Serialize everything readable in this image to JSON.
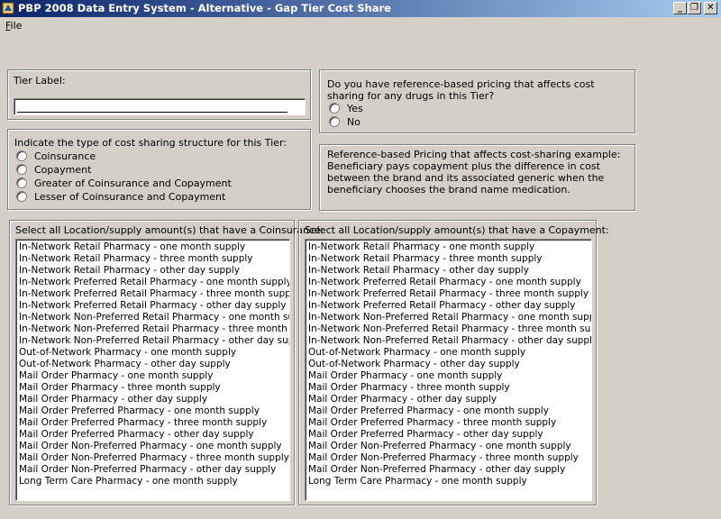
{
  "window": {
    "title": "PBP 2008 Data Entry System - Alternative - Gap Tier Cost Share",
    "minimize": "_",
    "restore": "❐",
    "close": "✕"
  },
  "menu": {
    "file_label_accel": "F",
    "file_label_rest": "ile"
  },
  "tier_label": {
    "caption": "Tier Label:",
    "value": ""
  },
  "reference_pricing": {
    "question": "Do you have reference-based pricing that affects cost sharing for any drugs in this Tier?",
    "options": [
      "Yes",
      "No"
    ]
  },
  "cost_sharing": {
    "caption": "Indicate the type of cost sharing structure for this Tier:",
    "options": [
      "Coinsurance",
      "Copayment",
      "Greater of Coinsurance and Copayment",
      "Lesser of Coinsurance and Copayment"
    ]
  },
  "example": {
    "text": "Reference-based Pricing that affects cost-sharing example: Beneficiary pays copayment plus the difference in cost between the brand and its associated generic when the beneficiary chooses the brand name medication."
  },
  "coinsurance_list": {
    "caption": "Select all Location/supply amount(s) that have a Coinsurance:",
    "items": [
      "In-Network Retail Pharmacy - one month supply",
      "In-Network Retail Pharmacy - three month supply",
      "In-Network Retail Pharmacy - other day supply",
      "In-Network Preferred Retail Pharmacy - one month supply",
      "In-Network Preferred Retail Pharmacy - three month supply",
      "In-Network Preferred Retail Pharmacy - other day supply",
      "In-Network Non-Preferred Retail Pharmacy - one month supply",
      "In-Network Non-Preferred Retail Pharmacy - three month supply",
      "In-Network Non-Preferred Retail Pharmacy - other day supply",
      "Out-of-Network Pharmacy - one month supply",
      "Out-of-Network Pharmacy - other day supply",
      "Mail Order Pharmacy - one month supply",
      "Mail Order Pharmacy - three month supply",
      "Mail Order Pharmacy - other day supply",
      "Mail Order Preferred Pharmacy - one month supply",
      "Mail Order Preferred Pharmacy - three month supply",
      "Mail Order Preferred Pharmacy - other day supply",
      "Mail Order Non-Preferred Pharmacy - one month supply",
      "Mail Order Non-Preferred Pharmacy - three month supply",
      "Mail Order Non-Preferred Pharmacy - other day supply",
      "Long Term Care Pharmacy - one month supply"
    ]
  },
  "copayment_list": {
    "caption": "Select all Location/supply amount(s) that have a Copayment:",
    "items": [
      "In-Network Retail Pharmacy - one month supply",
      "In-Network Retail Pharmacy - three month supply",
      "In-Network Retail Pharmacy - other day supply",
      "In-Network Preferred Retail Pharmacy - one month supply",
      "In-Network Preferred Retail Pharmacy - three month supply",
      "In-Network Preferred Retail Pharmacy - other day supply",
      "In-Network Non-Preferred Retail Pharmacy - one month supply",
      "In-Network Non-Preferred Retail Pharmacy - three month supply",
      "In-Network Non-Preferred Retail Pharmacy - other day supply",
      "Out-of-Network Pharmacy - one month supply",
      "Out-of-Network Pharmacy - other day supply",
      "Mail Order Pharmacy - one month supply",
      "Mail Order Pharmacy - three month supply",
      "Mail Order Pharmacy - other day supply",
      "Mail Order Preferred Pharmacy - one month supply",
      "Mail Order Preferred Pharmacy - three month supply",
      "Mail Order Preferred Pharmacy - other day supply",
      "Mail Order Non-Preferred Pharmacy - one month supply",
      "Mail Order Non-Preferred Pharmacy - three month supply",
      "Mail Order Non-Preferred Pharmacy - other day supply",
      "Long Term Care Pharmacy - one month supply"
    ]
  }
}
